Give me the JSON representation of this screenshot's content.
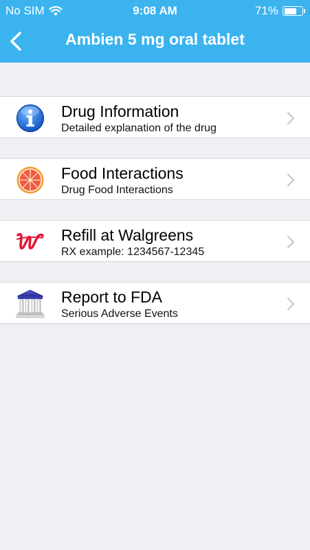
{
  "status_bar": {
    "carrier": "No SIM",
    "time": "9:08 AM",
    "battery_percent": "71%",
    "battery_level": 0.71
  },
  "nav": {
    "title": "Ambien 5 mg oral tablet",
    "back_icon": "chevron-left-icon"
  },
  "menu": [
    {
      "title": "Drug Information",
      "subtitle": "Detailed explanation of the drug",
      "icon": "info-icon"
    },
    {
      "title": "Food Interactions",
      "subtitle": "Drug Food Interactions",
      "icon": "grapefruit-icon"
    },
    {
      "title": "Refill at Walgreens",
      "subtitle": "RX example: 1234567-12345",
      "icon": "walgreens-logo-icon"
    },
    {
      "title": "Report to FDA",
      "subtitle": "Serious Adverse Events",
      "icon": "government-building-icon"
    }
  ],
  "colors": {
    "header": "#3bb3ef",
    "background": "#efeff4",
    "info_blue": "#1e6fd9",
    "walgreens_red": "#e31837"
  }
}
